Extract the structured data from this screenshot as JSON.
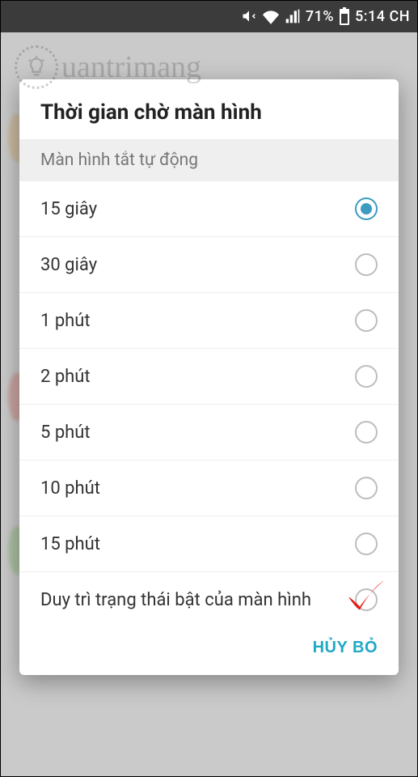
{
  "status_bar": {
    "battery_text": "71%",
    "time_text": "5:14 CH",
    "icons": {
      "mute": "volume-mute-icon",
      "wifi": "wifi-icon",
      "signal": "cell-signal-icon",
      "battery": "battery-icon"
    }
  },
  "watermark": {
    "text": "uantrimang"
  },
  "dialog": {
    "title": "Thời gian chờ màn hình",
    "section_header": "Màn hình tắt tự động",
    "cancel_label": "HỦY BỎ",
    "selected_index": 0,
    "options": [
      {
        "label": "15 giây"
      },
      {
        "label": "30 giây"
      },
      {
        "label": "1 phút"
      },
      {
        "label": "2 phút"
      },
      {
        "label": "5 phút"
      },
      {
        "label": "10 phút"
      },
      {
        "label": "15 phút"
      },
      {
        "label": "Duy trì trạng thái bật của màn hình"
      }
    ]
  },
  "annotation": {
    "check_color": "#e41a12"
  }
}
